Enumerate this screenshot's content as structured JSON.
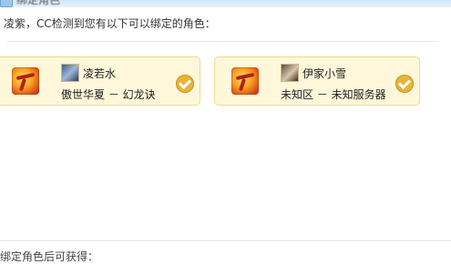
{
  "window": {
    "title": "绑定角色",
    "icon": "app-window-icon"
  },
  "prompt": "凌紫，CC检测到您有以下可以绑定的角色：",
  "roles": [
    {
      "game_icon": "game-logo-icon",
      "avatar": "role-avatar",
      "name": "凌若水",
      "server": "傲世华夏 － 幻龙诀",
      "selected": true
    },
    {
      "game_icon": "game-logo-icon",
      "avatar": "role-avatar",
      "name": "伊家小雪",
      "server": "未知区 － 未知服务器",
      "selected": true
    }
  ],
  "footer": {
    "text": "绑定角色后可获得："
  },
  "colors": {
    "card_bg": "#fff7da",
    "card_border": "#f1d88e",
    "check": "#e5b43a"
  }
}
